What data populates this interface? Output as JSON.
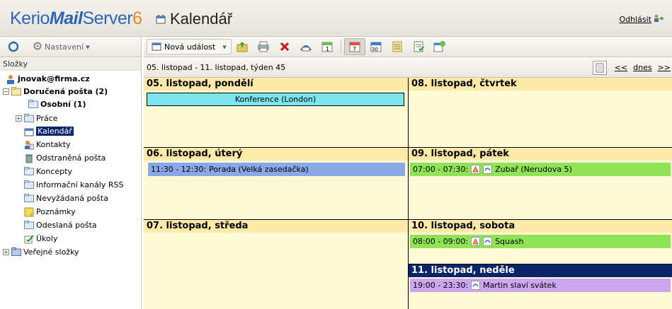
{
  "header": {
    "logo_parts": [
      "Kerio",
      "Mail",
      "Server",
      "6"
    ],
    "page_title": "Kalendář",
    "logout": "Odhlásit"
  },
  "left_toolbar": {
    "settings": "Nastavení"
  },
  "toolbar": {
    "new_event": "Nová událost",
    "icons": [
      "move-to-folder-icon",
      "print-icon",
      "delete-icon",
      "send-icon",
      "day-view-icon",
      "week-view-icon",
      "month-view-icon",
      "list-icon",
      "task-icon",
      "calendar-settings-icon"
    ]
  },
  "sidebar": {
    "label": "Složky",
    "items": [
      {
        "label": "jnovak@firma.cz",
        "icon": "user-icon"
      },
      {
        "label": "Doručená pošta (2)",
        "icon": "inbox-folder-icon"
      },
      {
        "label": "Osobní (1)",
        "icon": "folder-icon"
      },
      {
        "label": "Práce",
        "icon": "folder-icon"
      },
      {
        "label": "Kalendář",
        "icon": "calendar-icon"
      },
      {
        "label": "Kontakty",
        "icon": "contacts-icon"
      },
      {
        "label": "Odstraněná pošta",
        "icon": "trash-icon"
      },
      {
        "label": "Koncepty",
        "icon": "folder-icon"
      },
      {
        "label": "Informační kanály RSS",
        "icon": "folder-icon"
      },
      {
        "label": "Nevyžádaná pošta",
        "icon": "folder-icon"
      },
      {
        "label": "Poznámky",
        "icon": "notes-icon"
      },
      {
        "label": "Odeslaná pošta",
        "icon": "folder-icon"
      },
      {
        "label": "Úkoly",
        "icon": "tasks-icon"
      },
      {
        "label": "Veřejné složky",
        "icon": "public-folder-icon"
      }
    ]
  },
  "calendar": {
    "range_label": "05. listopad - 11. listopad, týden 45",
    "nav": {
      "prev": "<<",
      "today": "dnes",
      "next": ">>"
    },
    "days": [
      {
        "title": "05. listopad, pondělí",
        "events": [
          {
            "text": "Konference (London)"
          }
        ]
      },
      {
        "title": "06. listopad, úterý",
        "events": [
          {
            "time": "11:30 - 12:30:",
            "text": "Porada (Velká zasedačka)"
          }
        ]
      },
      {
        "title": "07. listopad, středa",
        "events": []
      },
      {
        "title": "08. listopad, čtvrtek",
        "events": []
      },
      {
        "title": "09. listopad, pátek",
        "events": [
          {
            "time": "07:00 - 07:30:",
            "text": "Zubař (Nerudova 5)"
          }
        ]
      },
      {
        "title": "10. listopad, sobota",
        "events": [
          {
            "time": "08:00 - 09:00:",
            "text": "Squash"
          }
        ]
      },
      {
        "title": "11. listopad, neděle",
        "events": [
          {
            "time": "19:00 - 23:30:",
            "text": "Martin slaví svátek"
          }
        ]
      }
    ]
  },
  "colors": {
    "day_header": "#fde9a8",
    "day_body": "#fff9d6",
    "today_header": "#0a246a",
    "event_allday": "#7be6ef",
    "event_blue": "#8aa7e8",
    "event_green": "#8fe354",
    "event_purple": "#cda6f0"
  }
}
